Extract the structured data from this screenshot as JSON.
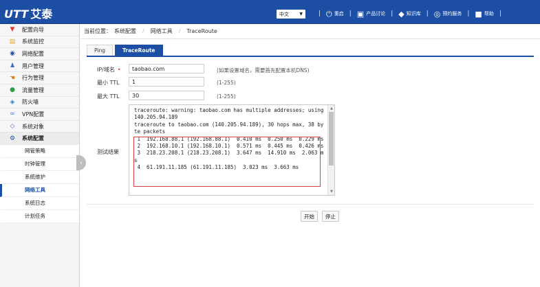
{
  "header": {
    "logo_brand": "UTT",
    "logo_name": "艾泰",
    "language": "中文",
    "nav": [
      {
        "icon": "restart-icon",
        "glyph": "⏻",
        "label": "重启"
      },
      {
        "icon": "forum-icon",
        "glyph": "▣",
        "label": "产品讨论"
      },
      {
        "icon": "knowledge-icon",
        "glyph": "◆",
        "label": "知识库"
      },
      {
        "icon": "service-icon",
        "glyph": "◎",
        "label": "预约服务"
      },
      {
        "icon": "help-icon",
        "glyph": "■",
        "label": "帮助"
      }
    ]
  },
  "sidebar": {
    "items": [
      {
        "label": "配置向导",
        "icon": "pin-icon",
        "glyph": "📍",
        "color": "#e53935"
      },
      {
        "label": "系统监控",
        "icon": "monitor-icon",
        "glyph": "▤",
        "color": "#f2a31b"
      },
      {
        "label": "网络配置",
        "icon": "globe-icon",
        "glyph": "◉",
        "color": "#1c4fa3"
      },
      {
        "label": "用户管理",
        "icon": "users-icon",
        "glyph": "👥",
        "color": "#3a6fc4"
      },
      {
        "label": "行为管理",
        "icon": "hand-icon",
        "glyph": "✋",
        "color": "#e07a1f"
      },
      {
        "label": "流量管理",
        "icon": "traffic-icon",
        "glyph": "●",
        "color": "#2e9c4a"
      },
      {
        "label": "防火墙",
        "icon": "firewall-icon",
        "glyph": "◈",
        "color": "#2f7fd1"
      },
      {
        "label": "VPN配置",
        "icon": "vpn-icon",
        "glyph": "∞",
        "color": "#2f7fd1"
      },
      {
        "label": "系统对象",
        "icon": "object-icon",
        "glyph": "◇",
        "color": "#7a55b0"
      },
      {
        "label": "系统配置",
        "icon": "gear-icon",
        "glyph": "⚙",
        "color": "#1c4fa3"
      }
    ],
    "subitems": [
      "网管策略",
      "时钟管理",
      "系统维护",
      "网络工具",
      "系统日志",
      "计划任务"
    ]
  },
  "breadcrumb": {
    "prefix": "当前位置：",
    "path": [
      "系统配置",
      "网络工具",
      "TraceRoute"
    ]
  },
  "tabs": [
    "Ping",
    "TraceRoute"
  ],
  "form": {
    "host_label": "IP/域名",
    "host_value": "taobao.com",
    "host_hint": "(如果设置域名，需要首先配置本机DNS)",
    "min_ttl_label": "最小 TTL",
    "min_ttl_value": "1",
    "min_ttl_hint": "(1-255)",
    "max_ttl_label": "最大 TTL",
    "max_ttl_value": "30",
    "max_ttl_hint": "(1-255)",
    "result_label": "测试结果",
    "result_lines": [
      "traceroute: warning: taobao.com has multiple addresses; using 140.205.94.189",
      "traceroute to taobao.com (140.205.94.189), 30 hops max, 38 byte packets",
      " 1  192.168.88.1 (192.168.88.1)  0.410 ms  0.250 ms  0.229 ms",
      " 2  192.168.10.1 (192.168.10.1)  0.571 ms  0.445 ms  0.426 ms",
      " 3  218.23.208.1 (218.23.208.1)  3.647 ms  14.910 ms  2.063 ms",
      " 4  61.191.11.185 (61.191.11.185)  3.023 ms  3.663 ms"
    ]
  },
  "buttons": {
    "start": "开始",
    "stop": "停止"
  },
  "colors": {
    "brand": "#1c4fa3",
    "highlight": "#d43f3f"
  }
}
